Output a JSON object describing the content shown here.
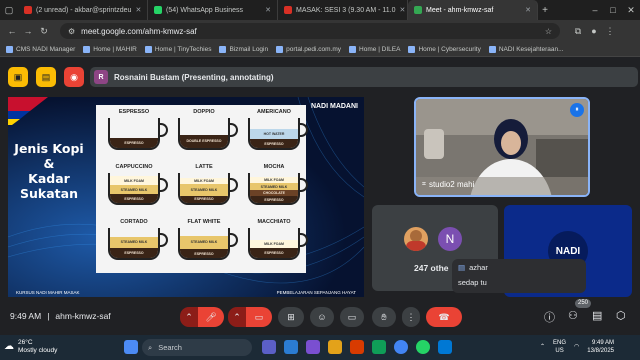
{
  "browser": {
    "tabs": [
      {
        "title": "(2 unread) - akbar@sprintzdeu",
        "fav_color": "#d93025",
        "active": false
      },
      {
        "title": "(54) WhatsApp Business",
        "fav_color": "#25d366",
        "active": false
      },
      {
        "title": "MASAK: SESI 3 (9.30 AM - 11.0",
        "fav_color": "#d93025",
        "active": false
      },
      {
        "title": "Meet - ahm-kmwz-saf",
        "fav_color": "#34a853",
        "active": true
      }
    ],
    "new_tab": "+",
    "url": "meet.google.com/ahm-kmwz-saf",
    "bookmarks": [
      "CMS NADI Manager",
      "Home | MAHIR",
      "Home | TinyTechies",
      "Bizmail Login",
      "portal.pedi.com.my",
      "Home | DILEA",
      "Home | Cybersecurity",
      "NADI Kesejahteraan..."
    ]
  },
  "meet": {
    "presenter": "Rosnaini Bustam (Presenting, annotating)",
    "presenter_initial": "R",
    "slide": {
      "title_lines": [
        "Jenis Kopi",
        "&",
        "Kadar",
        "Sukatan"
      ],
      "logo": "NADI MADANI",
      "footer_left": "KURSUS NADI MAHIR MASAK",
      "footer_right": "PEMBELAJARAN SEPANJANG HAYAT",
      "cups": [
        {
          "name": "ESPRESSO",
          "layers": [
            {
              "label": "ESPRESSO",
              "color": "#3a2416",
              "text": "#f5e6d3",
              "h": 0.35
            }
          ]
        },
        {
          "name": "DOPPIO",
          "layers": [
            {
              "label": "DOUBLE ESPRESSO",
              "color": "#3a2416",
              "text": "#f5e6d3",
              "h": 0.45
            }
          ]
        },
        {
          "name": "AMERICANO",
          "layers": [
            {
              "label": "ESPRESSO",
              "color": "#3a2416",
              "text": "#f5e6d3",
              "h": 0.3
            },
            {
              "label": "HOT WATER",
              "color": "#bcd7ea",
              "text": "#333",
              "h": 0.35
            }
          ]
        },
        {
          "name": "CAPPUCCINO",
          "layers": [
            {
              "label": "ESPRESSO",
              "color": "#3a2416",
              "text": "#f5e6d3",
              "h": 0.3
            },
            {
              "label": "STEAMED MILK",
              "color": "#e8c66b",
              "text": "#333",
              "h": 0.3
            },
            {
              "label": "MILK FOAM",
              "color": "#fff6dc",
              "text": "#333",
              "h": 0.3
            }
          ]
        },
        {
          "name": "LATTE",
          "layers": [
            {
              "label": "ESPRESSO",
              "color": "#3a2416",
              "text": "#f5e6d3",
              "h": 0.25
            },
            {
              "label": "STEAMED MILK",
              "color": "#e8c66b",
              "text": "#333",
              "h": 0.4
            },
            {
              "label": "MILK FOAM",
              "color": "#fff6dc",
              "text": "#333",
              "h": 0.2
            }
          ]
        },
        {
          "name": "MOCHA",
          "layers": [
            {
              "label": "ESPRESSO",
              "color": "#3a2416",
              "text": "#f5e6d3",
              "h": 0.22
            },
            {
              "label": "CHOCOLATE",
              "color": "#6b4226",
              "text": "#f5e6d3",
              "h": 0.22
            },
            {
              "label": "STEAMED MILK",
              "color": "#e8c66b",
              "text": "#333",
              "h": 0.22
            },
            {
              "label": "MILK FOAM",
              "color": "#fff6dc",
              "text": "#333",
              "h": 0.2
            }
          ]
        },
        {
          "name": "CORTADO",
          "layers": [
            {
              "label": "ESPRESSO",
              "color": "#3a2416",
              "text": "#f5e6d3",
              "h": 0.35
            },
            {
              "label": "STEAMED MILK",
              "color": "#e8c66b",
              "text": "#333",
              "h": 0.35
            }
          ]
        },
        {
          "name": "FLAT WHITE",
          "layers": [
            {
              "label": "ESPRESSO",
              "color": "#3a2416",
              "text": "#f5e6d3",
              "h": 0.3
            },
            {
              "label": "STEAMED MILK",
              "color": "#e8c66b",
              "text": "#333",
              "h": 0.45
            }
          ]
        },
        {
          "name": "MACCHIATO",
          "layers": [
            {
              "label": "ESPRESSO",
              "color": "#3a2416",
              "text": "#f5e6d3",
              "h": 0.35
            },
            {
              "label": "MILK FOAM",
              "color": "#fff6dc",
              "text": "#333",
              "h": 0.25
            }
          ]
        }
      ]
    },
    "participants": {
      "camera_label": "studio2 mahi",
      "others_count": "247 othe",
      "others_avatar": "N",
      "nadi_tile": "NADI"
    },
    "chat": {
      "author": "azhar",
      "message": "sedap tu"
    },
    "meeting_time": "9:49 AM",
    "meeting_code": "ahm-kmwz-saf",
    "participants_badge": "250"
  },
  "taskbar": {
    "temp": "26°C",
    "weather": "Mostly cloudy",
    "search_placeholder": "Search",
    "lang": "ENG",
    "region": "US",
    "time": "9:49 AM",
    "date": "13/8/2025"
  }
}
